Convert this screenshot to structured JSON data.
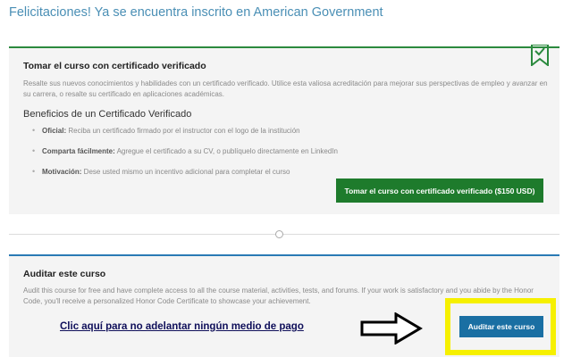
{
  "page": {
    "title": "Felicitaciones! Ya se encuentra inscrito en American Government"
  },
  "verified": {
    "title": "Tomar el curso con certificado verificado",
    "description": "Resalte sus nuevos conocimientos y habilidades con un certificado verificado. Utilice esta valiosa acreditación para mejorar sus perspectivas de empleo y avanzar en su carrera, o resalte su certificado en aplicaciones académicas.",
    "benefits_heading": "Beneficios de un Certificado Verificado",
    "benefits": [
      {
        "label": "Oficial:",
        "text": " Reciba un certificado firmado por el instructor con el logo de la institución"
      },
      {
        "label": "Comparta fácilmente:",
        "text": " Agregue el certificado a su CV, o publíquelo directamente en LinkedIn"
      },
      {
        "label": "Motivación:",
        "text": " Dese usted mismo un incentivo adicional para completar el curso"
      }
    ],
    "button_label": "Tomar el curso con certificado verificado ($150 USD)",
    "ribbon_icon": "bookmark-check-icon"
  },
  "audit": {
    "title": "Auditar este curso",
    "description": "Audit this course for free and have complete access to all the course material, activities, tests, and forums. If your work is satisfactory and you abide by the Honor Code, you'll receive a personalized Honor Code Certificate to showcase your achievement.",
    "note": "Clic aquí para no adelantar ningún medio de pago",
    "button_label": "Auditar este curso"
  },
  "colors": {
    "title_blue": "#4a8fb5",
    "verified_green": "#1e7b2c",
    "audit_blue": "#1a6fa3",
    "highlight_yellow": "#f6f000",
    "note_navy": "#0f0f5a"
  }
}
